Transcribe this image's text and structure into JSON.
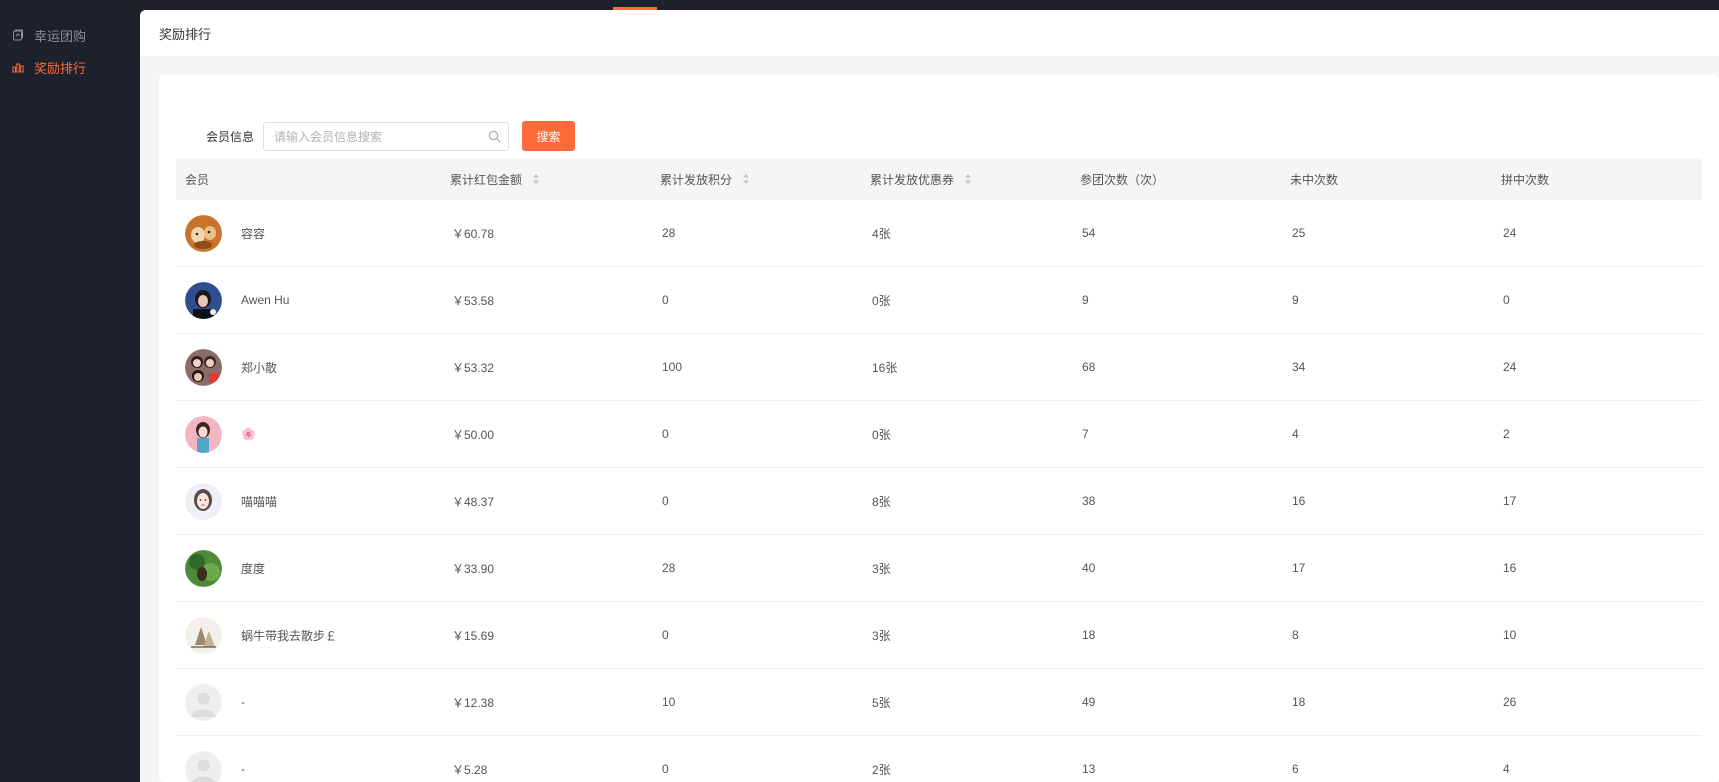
{
  "sidebar": {
    "items": [
      {
        "label": "幸运团购",
        "icon": "group-buy-icon",
        "active": false
      },
      {
        "label": "奖励排行",
        "icon": "ranking-icon",
        "active": true
      }
    ]
  },
  "header": {
    "title": "奖励排行"
  },
  "search": {
    "label": "会员信息",
    "placeholder": "请输入会员信息搜索",
    "value": "",
    "button_label": "搜索"
  },
  "table": {
    "columns": [
      {
        "label": "会员",
        "sortable": false
      },
      {
        "label": "累计红包金额",
        "sortable": true
      },
      {
        "label": "累计发放积分",
        "sortable": true
      },
      {
        "label": "累计发放优惠券",
        "sortable": true
      },
      {
        "label": "参团次数（次）",
        "sortable": false
      },
      {
        "label": "未中次数",
        "sortable": false
      },
      {
        "label": "拼中次数",
        "sortable": false
      }
    ],
    "rows": [
      {
        "name": "容容",
        "avatar": "avatar-dog",
        "amount": "￥60.78",
        "points": "28",
        "coupons": "4张",
        "joins": "54",
        "misses": "25",
        "wins": "24"
      },
      {
        "name": "Awen Hu",
        "avatar": "avatar-girl-blue",
        "amount": "￥53.58",
        "points": "0",
        "coupons": "0张",
        "joins": "9",
        "misses": "9",
        "wins": "0"
      },
      {
        "name": "郑小散",
        "avatar": "avatar-group",
        "amount": "￥53.32",
        "points": "100",
        "coupons": "16张",
        "joins": "68",
        "misses": "34",
        "wins": "24"
      },
      {
        "name": "🌸",
        "avatar": "avatar-girl-pink",
        "amount": "￥50.00",
        "points": "0",
        "coupons": "0张",
        "joins": "7",
        "misses": "4",
        "wins": "2"
      },
      {
        "name": "喵喵喵",
        "avatar": "avatar-girl-white",
        "amount": "￥48.37",
        "points": "0",
        "coupons": "8张",
        "joins": "38",
        "misses": "16",
        "wins": "17"
      },
      {
        "name": "度度",
        "avatar": "avatar-nature",
        "amount": "￥33.90",
        "points": "28",
        "coupons": "3张",
        "joins": "40",
        "misses": "17",
        "wins": "16"
      },
      {
        "name": "蜗牛带我去散步￡",
        "avatar": "avatar-sketch",
        "amount": "￥15.69",
        "points": "0",
        "coupons": "3张",
        "joins": "18",
        "misses": "8",
        "wins": "10"
      },
      {
        "name": "-",
        "avatar": "avatar-default",
        "amount": "￥12.38",
        "points": "10",
        "coupons": "5张",
        "joins": "49",
        "misses": "18",
        "wins": "26"
      },
      {
        "name": "-",
        "avatar": "avatar-default",
        "amount": "￥5.28",
        "points": "0",
        "coupons": "2张",
        "joins": "13",
        "misses": "6",
        "wins": "4"
      }
    ]
  },
  "colors": {
    "accent": "#ff6a3a",
    "sidebar_bg": "#1c212c"
  }
}
